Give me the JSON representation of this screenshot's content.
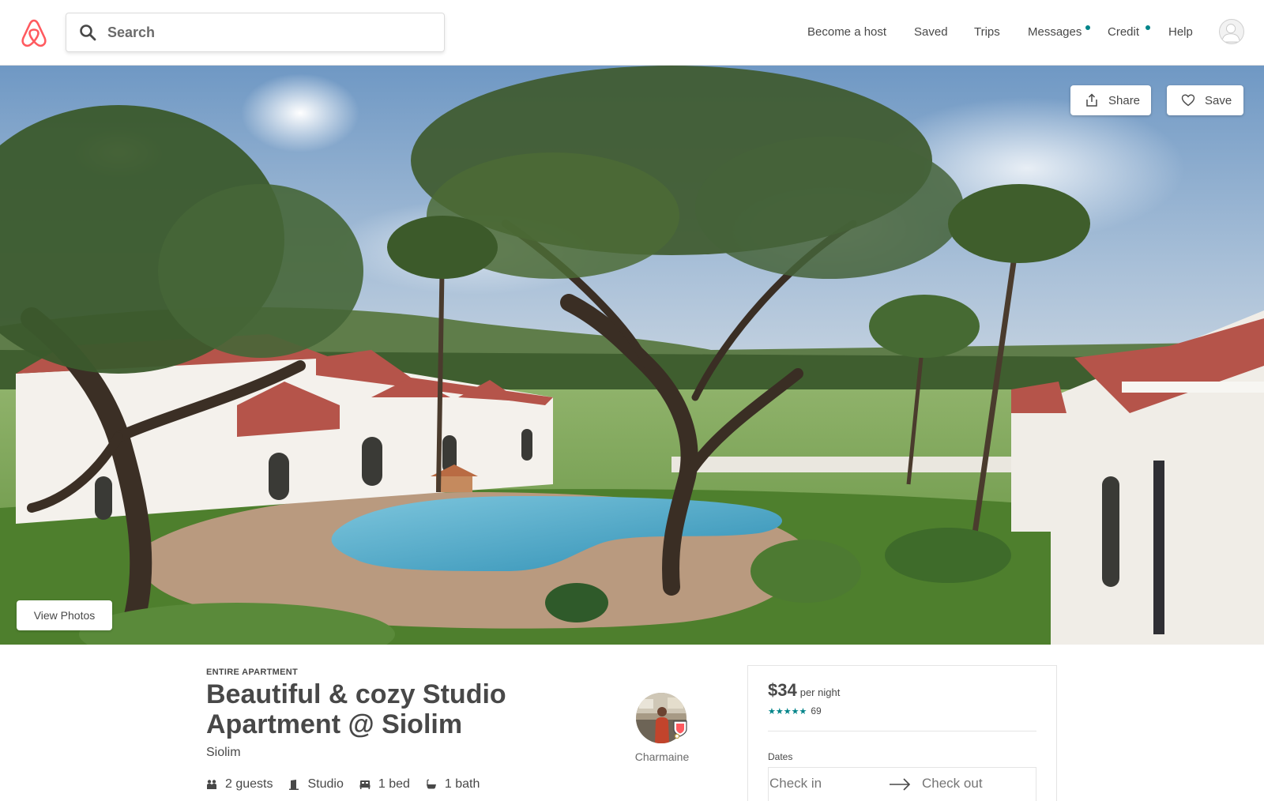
{
  "header": {
    "logo_icon": "airbnb-belo-icon",
    "brand_color": "#FF5A5F",
    "search": {
      "placeholder": "Search",
      "icon": "search-icon"
    },
    "nav": [
      {
        "label": "Become a host"
      },
      {
        "label": "Saved"
      },
      {
        "label": "Trips"
      },
      {
        "label": "Messages",
        "has_dot": true
      },
      {
        "label": "Credit",
        "has_dot": true
      },
      {
        "label": "Help"
      }
    ],
    "notification_dot_color": "#008489",
    "avatar_icon": "user-avatar-icon"
  },
  "hero": {
    "share_label": "Share",
    "share_icon": "share-icon",
    "save_label": "Save",
    "save_icon": "heart-icon",
    "view_photos_label": "View Photos"
  },
  "listing": {
    "type": "ENTIRE APARTMENT",
    "title": "Beautiful & cozy Studio Apartment @ Siolim",
    "location": "Siolim",
    "facts": [
      {
        "icon": "guests-icon",
        "label": "2 guests"
      },
      {
        "icon": "door-icon",
        "label": "Studio"
      },
      {
        "icon": "bed-icon",
        "label": "1 bed"
      },
      {
        "icon": "bath-icon",
        "label": "1 bath"
      }
    ],
    "host": {
      "name": "Charmaine",
      "badge_icon": "superhost-badge-icon"
    }
  },
  "booking": {
    "price": "$34",
    "price_unit": "per night",
    "stars": "★★★★★",
    "review_count": "69",
    "star_color": "#008489",
    "dates_label": "Dates",
    "check_in_placeholder": "Check in",
    "check_out_placeholder": "Check out",
    "arrow_icon": "arrow-right-icon"
  }
}
